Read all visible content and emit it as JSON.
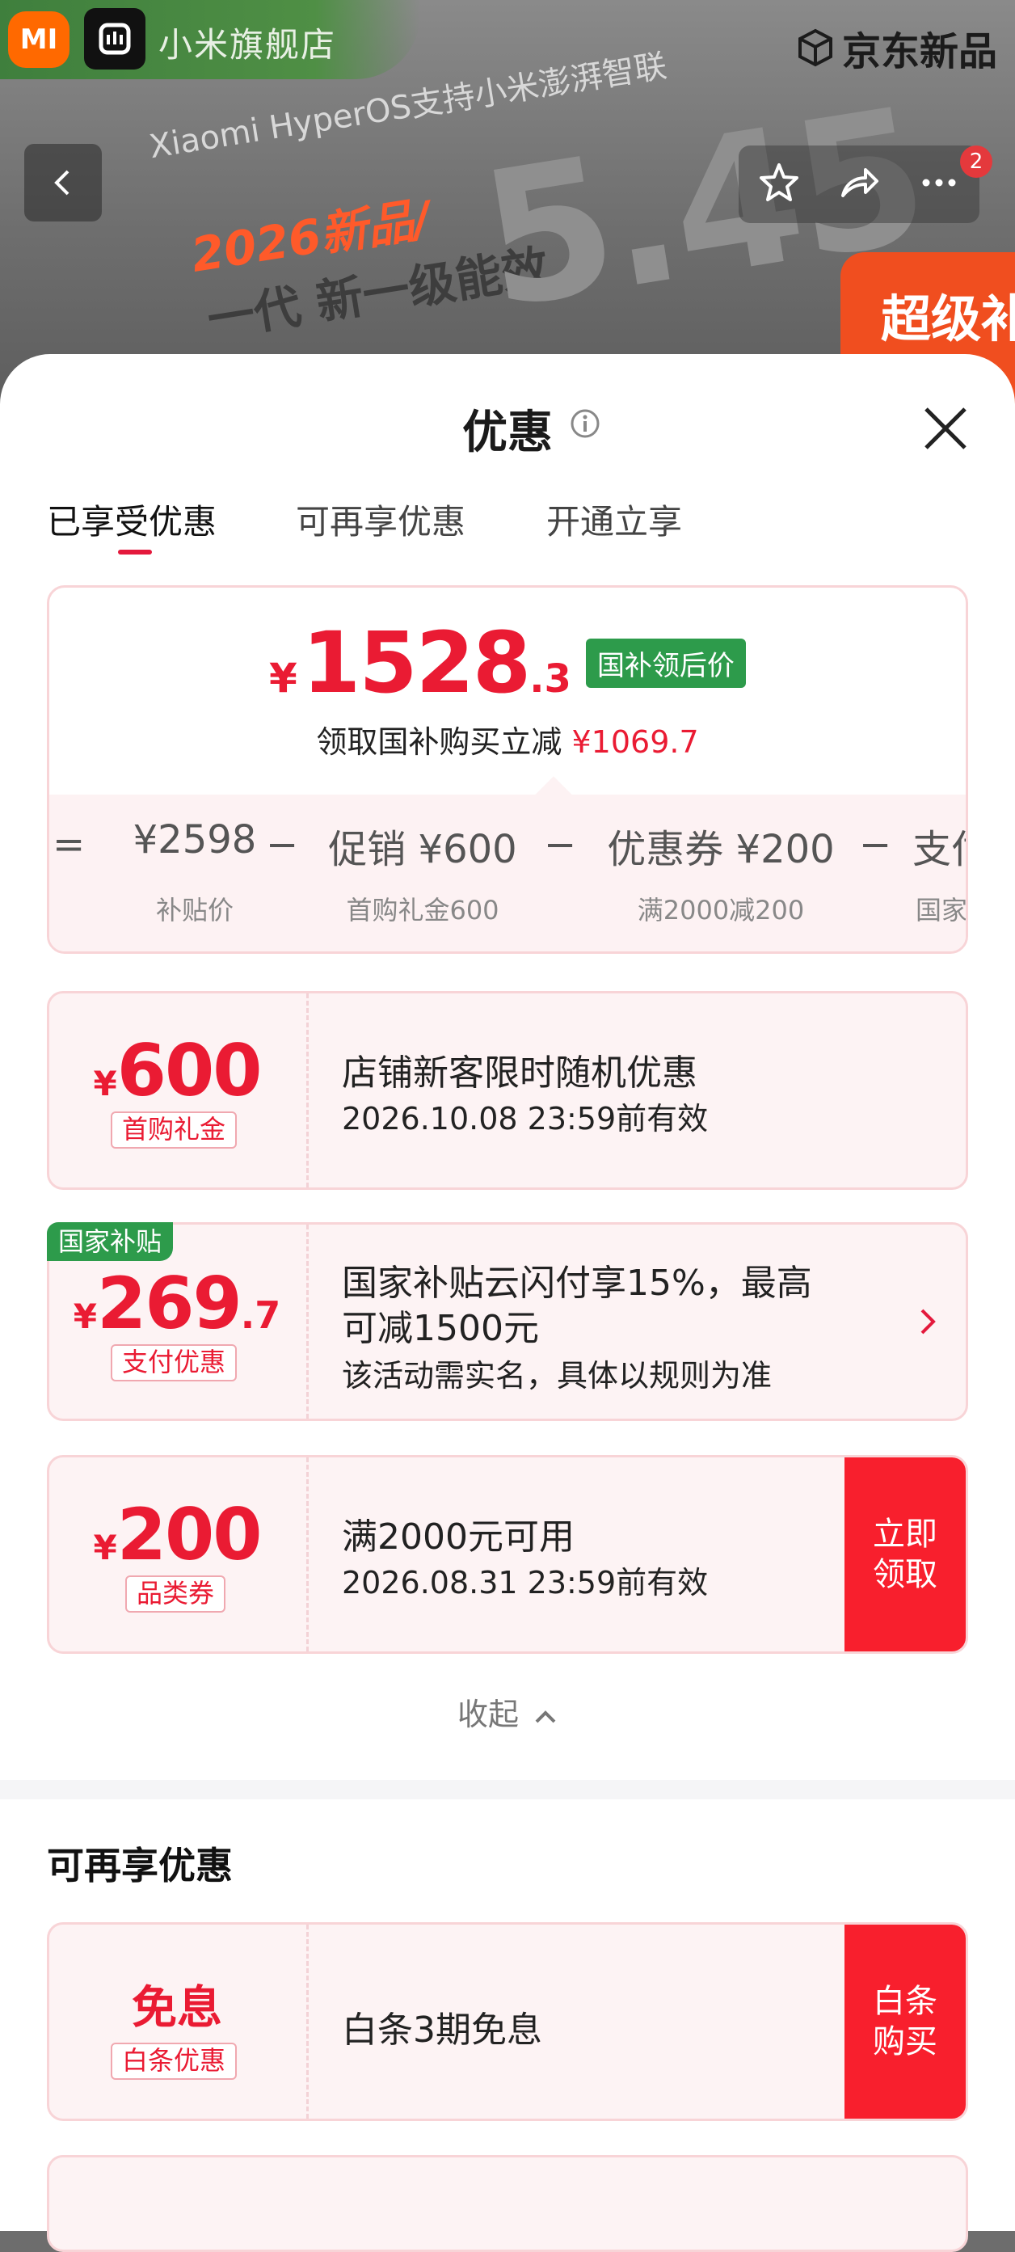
{
  "store": {
    "mi_logo": "MI",
    "name": "小米旗舰店",
    "brand_tag": "京东新品"
  },
  "header": {
    "cart_count": "2"
  },
  "promo": {
    "hyperos": "Xiaomi HyperOS支持小米澎湃智联",
    "headline": "2026新品/",
    "energy": "一代 新一级能效",
    "big": "5.45",
    "badge": "超级补贴"
  },
  "sheet": {
    "title": "优惠",
    "tabs": [
      "已享受优惠",
      "可再享优惠",
      "开通立享"
    ]
  },
  "summary": {
    "currency": "¥",
    "price_int": "1528",
    "price_dec": ".3",
    "price_tag": "国补领后价",
    "save_text": "领取国补购买立减",
    "save_value": "¥1069.7",
    "formula": [
      {
        "op": "=",
        "item": "¥2598",
        "sub": "补贴价"
      },
      {
        "op": "−",
        "item": "促销 ¥600",
        "sub": "首购礼金600"
      },
      {
        "op": "−",
        "item": "优惠券 ¥200",
        "sub": "满2000减200"
      },
      {
        "op": "−",
        "item": "支付",
        "sub": "国家"
      }
    ]
  },
  "coupons": [
    {
      "currency": "¥",
      "amount": "600",
      "decimal": "",
      "label": "首购礼金",
      "title": "店铺新客限时随机优惠",
      "desc": "2026.10.08 23:59前有效",
      "cta": ""
    },
    {
      "currency": "¥",
      "amount": "269",
      "decimal": ".7",
      "label": "支付优惠",
      "tag": "国家补贴",
      "title": "国家补贴云闪付享15%，最高",
      "title2": "可减1500元",
      "desc": "该活动需实名，具体以规则为准",
      "cta": ""
    },
    {
      "currency": "¥",
      "amount": "200",
      "decimal": "",
      "label": "品类券",
      "title": "满2000元可用",
      "desc": "2026.08.31 23:59前有效",
      "cta_line1": "立即",
      "cta_line2": "领取"
    }
  ],
  "collapse_label": "收起",
  "more_section": {
    "title": "可再享优惠",
    "items": [
      {
        "amount_text": "免息",
        "label": "白条优惠",
        "title": "白条3期免息",
        "cta_line1": "白条",
        "cta_line2": "购买"
      }
    ]
  }
}
